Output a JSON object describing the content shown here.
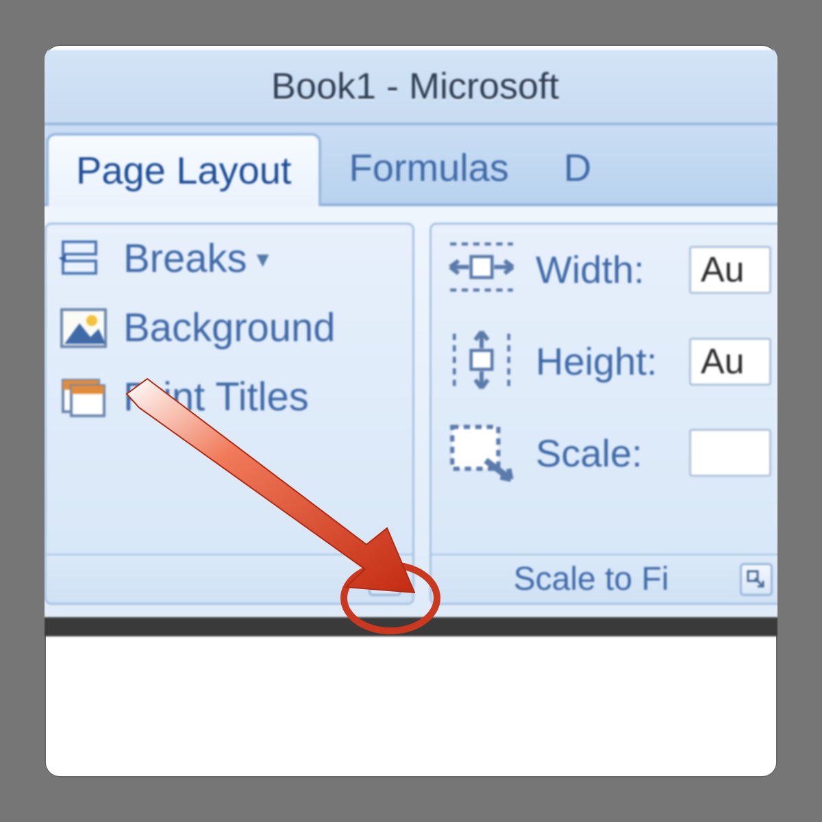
{
  "title": "Book1 - Microsoft",
  "tabs": {
    "page_layout": "Page Layout",
    "formulas": "Formulas",
    "data_partial": "D"
  },
  "page_setup_group": {
    "breaks": "Breaks",
    "background": "Background",
    "print_titles": "Print Titles",
    "caption": ""
  },
  "scale_to_fit_group": {
    "width_label": "Width:",
    "height_label": "Height:",
    "scale_label": "Scale:",
    "width_value": "Au",
    "height_value": "Au",
    "scale_value": "",
    "caption": "Scale to Fi"
  }
}
